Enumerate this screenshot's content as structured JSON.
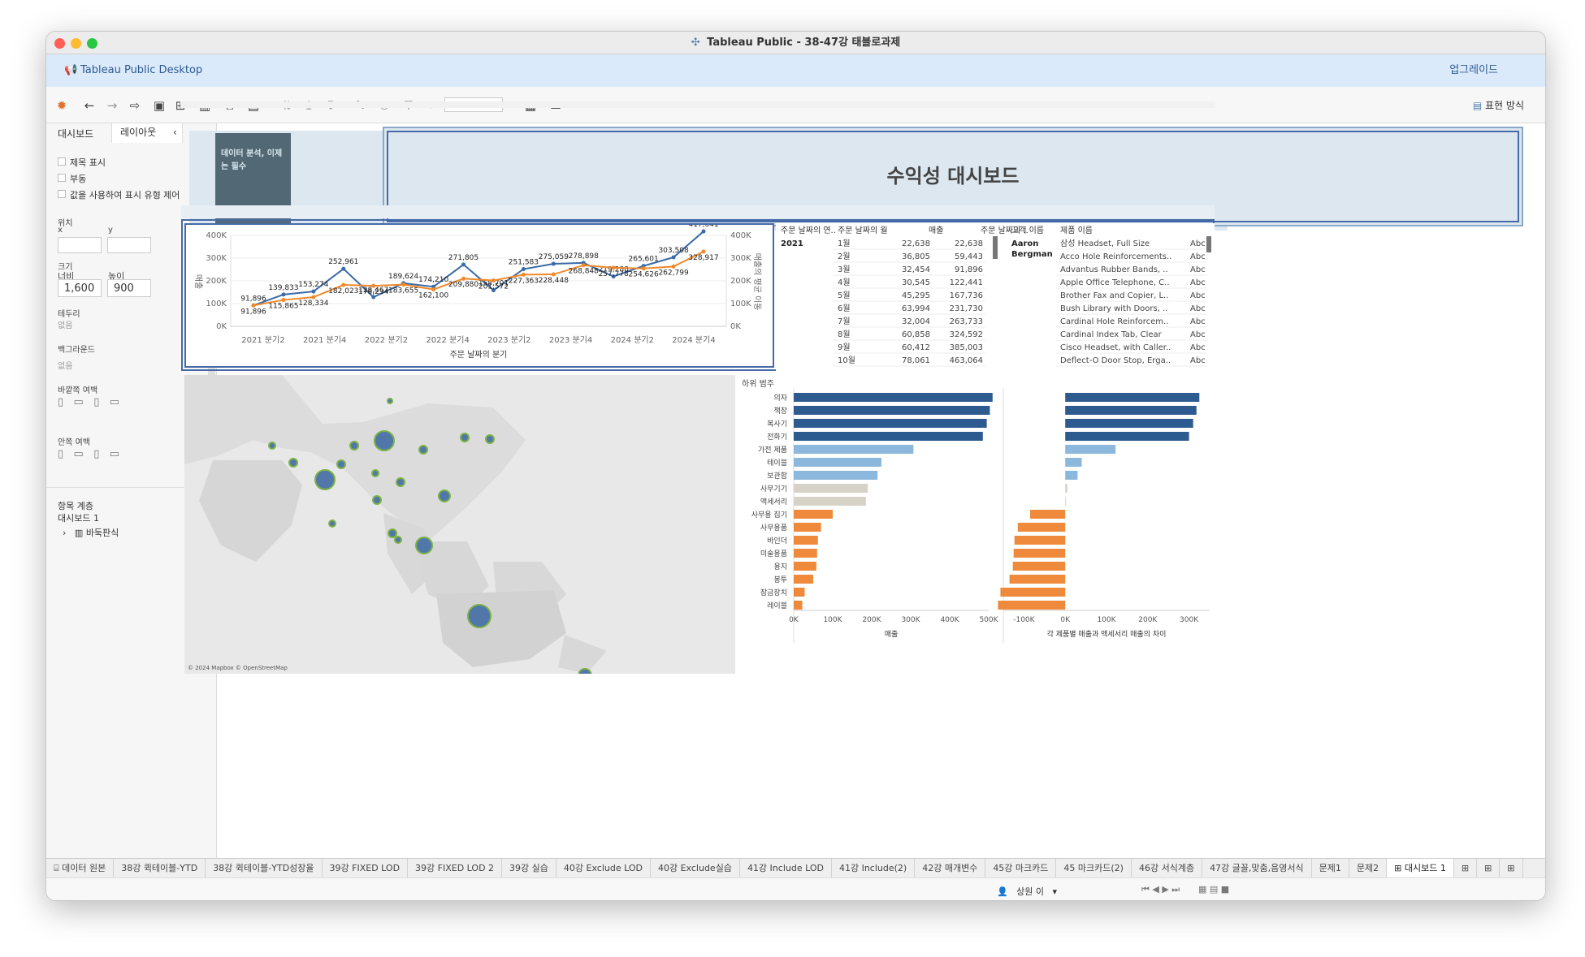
{
  "window": {
    "title": "Tableau Public - 38-47강 태블로과제",
    "notice_label": "Tableau Public Desktop",
    "upgrade_label": "업그레이드",
    "toolbar_right_label": "표현 방식"
  },
  "sidebar": {
    "tabs": [
      "대시보드",
      "레이아웃"
    ],
    "checkboxes": [
      "제목 표시",
      "부동",
      "값을 사용하여 표시 유형 제어"
    ],
    "position_label": "위치",
    "x_label": "x",
    "y_label": "y",
    "size_label": "크기",
    "width_label": "너비",
    "height_label": "높이",
    "width_value": "1,600",
    "height_value": "900",
    "border_label": "테두리",
    "border_value": "없음",
    "background_label": "백그라운드",
    "background_value": "없음",
    "outer_padding_label": "바깥쪽 여백",
    "inner_padding_label": "안쪽 여백",
    "hierarchy_label": "항목 계층",
    "dashboard_item": "대시보드 1",
    "tiled_item": "바둑판식"
  },
  "dashboard": {
    "title": "수익성 대시보드",
    "thumb_title": "데이터 분석, 이제는 필수",
    "map_credit": "© 2024 Mapbox © OpenStreetMap"
  },
  "line_chart": {
    "xlabel": "주문 날짜의 분기",
    "ylabel_left": "매출",
    "ylabel_right": "매출의 평균 이동",
    "ticks_left": [
      "400K",
      "300K",
      "200K",
      "100K",
      "0K"
    ],
    "ticks_right": [
      "400K",
      "300K",
      "200K",
      "100K",
      "0K"
    ],
    "quarters": [
      "2021 분기2",
      "2021 분기4",
      "2022 분기2",
      "2022 분기4",
      "2023 분기2",
      "2023 분기4",
      "2024 분기2",
      "2024 분기4"
    ]
  },
  "sales_table": {
    "headers": [
      "주문 날짜의 연..",
      "주문 날짜의 월",
      "매출",
      "주문 날짜의 .."
    ],
    "year": "2021",
    "rows": [
      [
        "1월",
        "22,638",
        "22,638"
      ],
      [
        "2월",
        "36,805",
        "59,443"
      ],
      [
        "3월",
        "32,454",
        "91,896"
      ],
      [
        "4월",
        "30,545",
        "122,441"
      ],
      [
        "5월",
        "45,295",
        "167,736"
      ],
      [
        "6월",
        "63,994",
        "231,730"
      ],
      [
        "7월",
        "32,004",
        "263,733"
      ],
      [
        "8월",
        "60,858",
        "324,592"
      ],
      [
        "9월",
        "60,412",
        "385,003"
      ],
      [
        "10월",
        "78,061",
        "463,064"
      ]
    ]
  },
  "customer_table": {
    "headers": [
      "고객 이름",
      "제품 이름"
    ],
    "customer": [
      "Aaron",
      "Bergman"
    ],
    "rows": [
      [
        "삼성 Headset, Full Size",
        "Abc"
      ],
      [
        "Acco Hole Reinforcements..",
        "Abc"
      ],
      [
        "Advantus Rubber Bands, ..",
        "Abc"
      ],
      [
        "Apple Office Telephone, C..",
        "Abc"
      ],
      [
        "Brother Fax and Copier, L..",
        "Abc"
      ],
      [
        "Bush Library with Doors, ..",
        "Abc"
      ],
      [
        "Cardinal Hole Reinforcem..",
        "Abc"
      ],
      [
        "Cardinal Index Tab, Clear",
        "Abc"
      ],
      [
        "Cisco Headset, with Caller..",
        "Abc"
      ],
      [
        "Deflect-O Door Stop, Erga..",
        "Abc"
      ]
    ]
  },
  "bar_chart": {
    "header": "하위 범주",
    "xlabel_left": "매출",
    "xlabel_right": "각 제품별 매출과 액세서리 매출의 차이",
    "ticks_left": [
      "0K",
      "100K",
      "200K",
      "300K",
      "400K",
      "500K"
    ],
    "ticks_right": [
      "-100K",
      "0K",
      "100K",
      "200K",
      "300K"
    ]
  },
  "chart_data": [
    {
      "type": "line",
      "x": [
        "2021 분기1",
        "2021 분기2",
        "2021 분기3",
        "2021 분기4",
        "2022 분기1",
        "2022 분기2",
        "2022 분기3",
        "2022 분기4",
        "2023 분기1",
        "2023 분기2",
        "2023 분기3",
        "2023 분기4",
        "2024 분기1",
        "2024 분기2",
        "2024 분기3",
        "2024 분기4"
      ],
      "series": [
        {
          "name": "매출",
          "values": [
            91896,
            139833,
            153274,
            252961,
            128467,
            189624,
            174210,
            271805,
            158701,
            251583,
            275059,
            278898,
            219288,
            265601,
            303508,
            417641
          ]
        },
        {
          "name": "매출의 평균 이동",
          "values": [
            91896,
            115865,
            128334,
            182023,
            178234,
            183655,
            162100,
            209880,
            201572,
            227363,
            228448,
            268848,
            257778,
            254626,
            262799,
            328917
          ]
        }
      ],
      "ylim": [
        0,
        400000
      ]
    },
    {
      "type": "bar",
      "categories": [
        "의자",
        "책장",
        "복사기",
        "전화기",
        "가전 제품",
        "테이블",
        "보관함",
        "사무기기",
        "액세서리",
        "사무용 집기",
        "사무용품",
        "바인더",
        "미술용품",
        "용지",
        "봉투",
        "잠금장치",
        "레이블"
      ],
      "series": [
        {
          "name": "매출",
          "values": [
            510000,
            503000,
            495000,
            485000,
            307000,
            225000,
            215000,
            190000,
            185000,
            100000,
            70000,
            62000,
            60000,
            58000,
            50000,
            28000,
            22000
          ]
        },
        {
          "name": "각 제품별 매출과 액세서리 매출의 차이",
          "values": [
            325000,
            318000,
            310000,
            300000,
            122000,
            40000,
            30000,
            5000,
            0,
            -85000,
            -115000,
            -123000,
            -125000,
            -127000,
            -135000,
            -157000,
            -163000
          ]
        }
      ]
    }
  ]
}
